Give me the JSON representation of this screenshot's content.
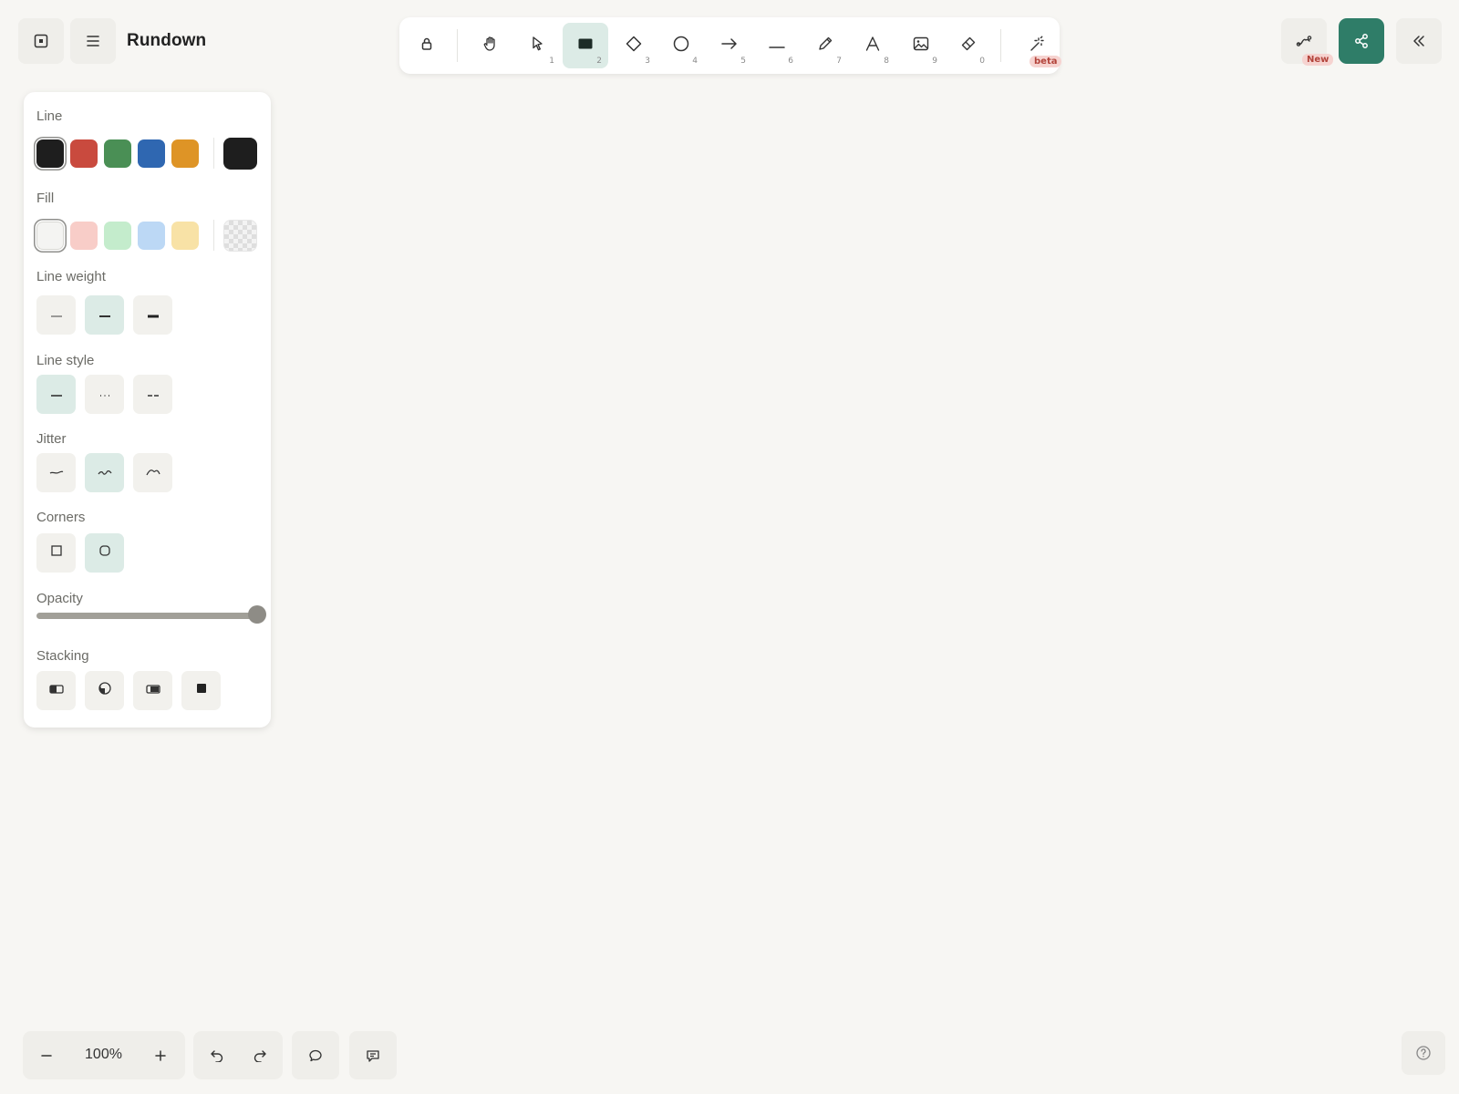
{
  "document": {
    "title": "Rundown"
  },
  "toolbar": {
    "tools": [
      {
        "name": "lock",
        "key": ""
      },
      {
        "name": "hand",
        "key": ""
      },
      {
        "name": "select",
        "key": "1"
      },
      {
        "name": "rectangle",
        "key": "2",
        "active": true
      },
      {
        "name": "diamond",
        "key": "3"
      },
      {
        "name": "ellipse",
        "key": "4"
      },
      {
        "name": "arrow",
        "key": "5"
      },
      {
        "name": "line",
        "key": "6"
      },
      {
        "name": "pencil",
        "key": "7"
      },
      {
        "name": "text",
        "key": "8"
      },
      {
        "name": "image",
        "key": "9"
      },
      {
        "name": "eraser",
        "key": "0"
      },
      {
        "name": "magic",
        "key": ""
      }
    ],
    "beta_badge": "beta"
  },
  "top_right": {
    "new_badge": "New",
    "share_color": "#2f7d68"
  },
  "panel": {
    "line_label": "Line",
    "line_colors": [
      "#1e1e1e",
      "#c94a3e",
      "#4a8f55",
      "#2f67b1",
      "#de9426"
    ],
    "line_custom_color": "#1e1e1e",
    "fill_label": "Fill",
    "fill_colors": [
      "#f4f4f2",
      "#f8cdc8",
      "#c4eccc",
      "#bcd8f5",
      "#f8e2a6"
    ],
    "line_weight_label": "Line weight",
    "line_style_label": "Line style",
    "jitter_label": "Jitter",
    "corners_label": "Corners",
    "opacity_label": "Opacity",
    "opacity_value": 1.0,
    "stacking_label": "Stacking"
  },
  "bottom": {
    "zoom": "100%"
  }
}
